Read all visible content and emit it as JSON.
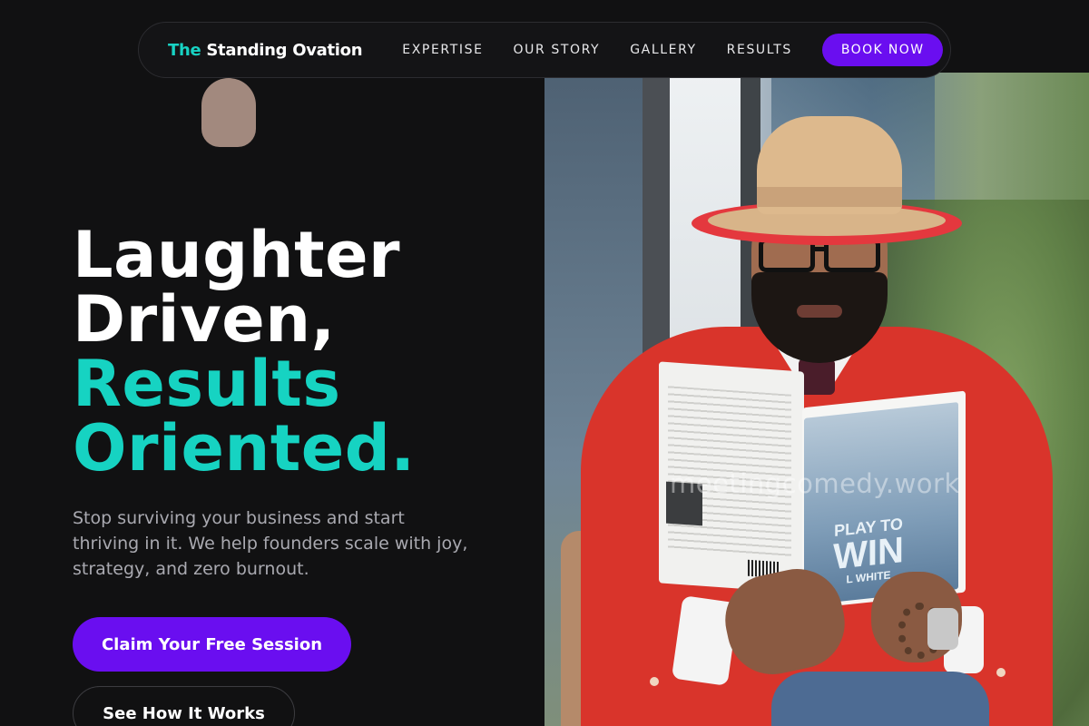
{
  "nav": {
    "brand_accent": "The",
    "brand_rest": "Standing Ovation",
    "links": [
      "EXPERTISE",
      "OUR STORY",
      "GALLERY",
      "RESULTS"
    ],
    "cta": "BOOK NOW"
  },
  "hero": {
    "headline": [
      "Laughter",
      "Driven,",
      "Results",
      "Oriented."
    ],
    "subtitle": "Stop surviving your business and start thriving in it. We help founders scale with joy, strategy, and zero burnout.",
    "primary_button": "Claim Your Free Session",
    "secondary_button": "See How It Works",
    "image": {
      "book_title_top": "PLAY TO",
      "book_title_main": "WIN",
      "book_author_partial": "L WHITE",
      "watermark": "meetingcomedy.work"
    }
  },
  "colors": {
    "background": "#111112",
    "accent_teal": "#16d3c2",
    "accent_purple": "#6a0ef0"
  }
}
